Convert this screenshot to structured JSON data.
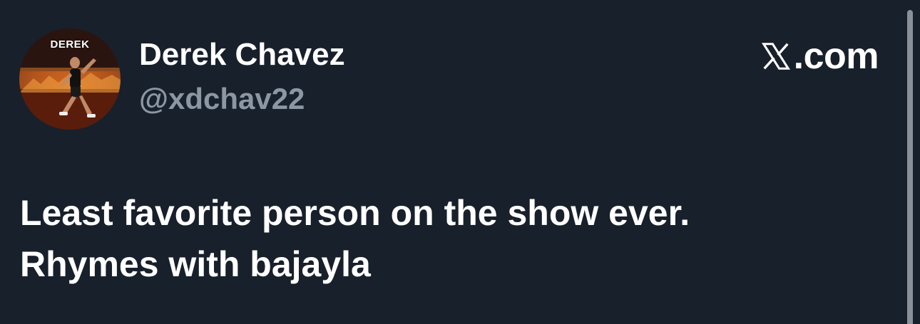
{
  "author": {
    "display_name": "Derek Chavez",
    "handle": "@xdchav22",
    "avatar_text": "DEREK"
  },
  "brand": {
    "domain": ".com",
    "icon": "x-logo-icon"
  },
  "post": {
    "lines": [
      "Least favorite person on the show ever.",
      "Rhymes with bajayla"
    ]
  },
  "colors": {
    "background": "#18202b",
    "primary_text": "#ffffff",
    "secondary_text": "#8b97a3"
  }
}
